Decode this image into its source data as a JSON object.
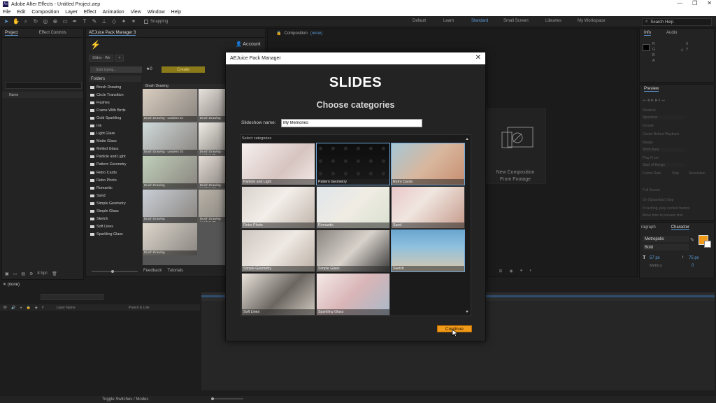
{
  "app": {
    "title": "Adobe After Effects - Untitled Project.aep",
    "logo_text": "Ae",
    "window_controls": [
      "—",
      "❐",
      "✕"
    ]
  },
  "menubar": [
    "File",
    "Edit",
    "Composition",
    "Layer",
    "Effect",
    "Animation",
    "View",
    "Window",
    "Help"
  ],
  "toolbar": {
    "snapping_label": "Snapping",
    "workspaces": [
      "Default",
      "Learn",
      "Standard",
      "Small Screen",
      "Libraries",
      "My Workspace"
    ],
    "active_workspace": "Standard",
    "help_placeholder": "Search Help"
  },
  "project_panel": {
    "tabs": [
      "Project",
      "Effect Controls"
    ],
    "column_name": "Name",
    "bpc": "8 bpc"
  },
  "aejuice_panel": {
    "tab": "AEJuice Pack Manager 3",
    "account": "Account",
    "sub_tab": "Slides - We",
    "search_placeholder": "Start typing...",
    "fav_count": "★0",
    "create_label": "Create",
    "folders_label": "Folders",
    "folders": [
      "Brush Drawing",
      "Circle Transition",
      "Flashes",
      "Frame With Birds",
      "Gold Sparkling",
      "Ink",
      "Light Glare",
      "Matte Glass",
      "Melted Glass",
      "Particle and Light",
      "Pattern Geometry",
      "Retro Cards",
      "Retro Photo",
      "Romantic",
      "Sand",
      "Simple Geometry",
      "Simple Glass",
      "Sketch",
      "Soft Lines",
      "Sparkling Glass"
    ],
    "preview_title": "Brush Drawing",
    "preview_labels": [
      "Brush Drawing - Leaders 01",
      "Brush Drawing",
      "Brush Drawing - Leaders 03",
      "Brush Drawing - Leaders 05",
      "Brush Drawing",
      "Brush Drawing - Leaders 07",
      "Brush Drawing",
      "Brush Drawing - Leaders 09",
      "Brush Drawing"
    ],
    "footer_links": [
      "Feedback",
      "Tutorials"
    ]
  },
  "composition_panel": {
    "tab": "Composition",
    "tab_value": "(none)",
    "new_comp_line1": "New Composition",
    "new_comp_line2": "From Footage"
  },
  "info_panel": {
    "tabs": [
      "Info",
      "Audio"
    ],
    "rgba": [
      "R",
      "G",
      "B",
      "A"
    ],
    "xy": [
      "X",
      "Y"
    ]
  },
  "preview_panel": {
    "tab": "Preview",
    "rows": [
      "Shortcut",
      "Spacebar",
      "Include",
      "Cache Before Playback",
      "Range",
      "Work Area",
      "Play From",
      "Start of Range",
      "Frame Rate",
      "Skip",
      "Resolution",
      "Full Screen",
      "On (Spacebar) Stop",
      "If caching, play cached frames",
      "Move time to preview time"
    ]
  },
  "character_panel": {
    "tabs": [
      "ragraph",
      "Character"
    ],
    "font": "Metropolis",
    "style": "Bold",
    "size": "57 px",
    "leading": "75 px",
    "tracking": "0",
    "kerning": "Metrics",
    "fill_color": "#f09a1a"
  },
  "timeline": {
    "tab": "(none)",
    "columns": [
      "Layer Name",
      "Parent & Link"
    ],
    "footer": "Toggle Switches / Modes"
  },
  "dialog": {
    "title": "AEJuice Pack Manager",
    "heading": "SLIDES",
    "subheading": "Choose categories",
    "name_label": "Slideshow name:",
    "name_value": "My Memories",
    "categories_label": "Select categories",
    "categories": [
      {
        "label": "Particle and Light",
        "selected": false
      },
      {
        "label": "Pattern Geometry",
        "selected": true
      },
      {
        "label": "Retro Cards",
        "selected": true
      },
      {
        "label": "Retro Photo",
        "selected": false
      },
      {
        "label": "Romantic",
        "selected": false
      },
      {
        "label": "Sand",
        "selected": false
      },
      {
        "label": "Simple Geometry",
        "selected": false
      },
      {
        "label": "Simple Glass",
        "selected": false
      },
      {
        "label": "Sketch",
        "selected": true
      },
      {
        "label": "Soft Lines",
        "selected": false
      },
      {
        "label": "Sparkling Glass",
        "selected": false
      }
    ],
    "continue_label": "Continue"
  },
  "colors": {
    "accent_orange": "#f09a1a",
    "selection_blue": "#6ea7d8",
    "workspace_active": "#5a9bd8"
  }
}
